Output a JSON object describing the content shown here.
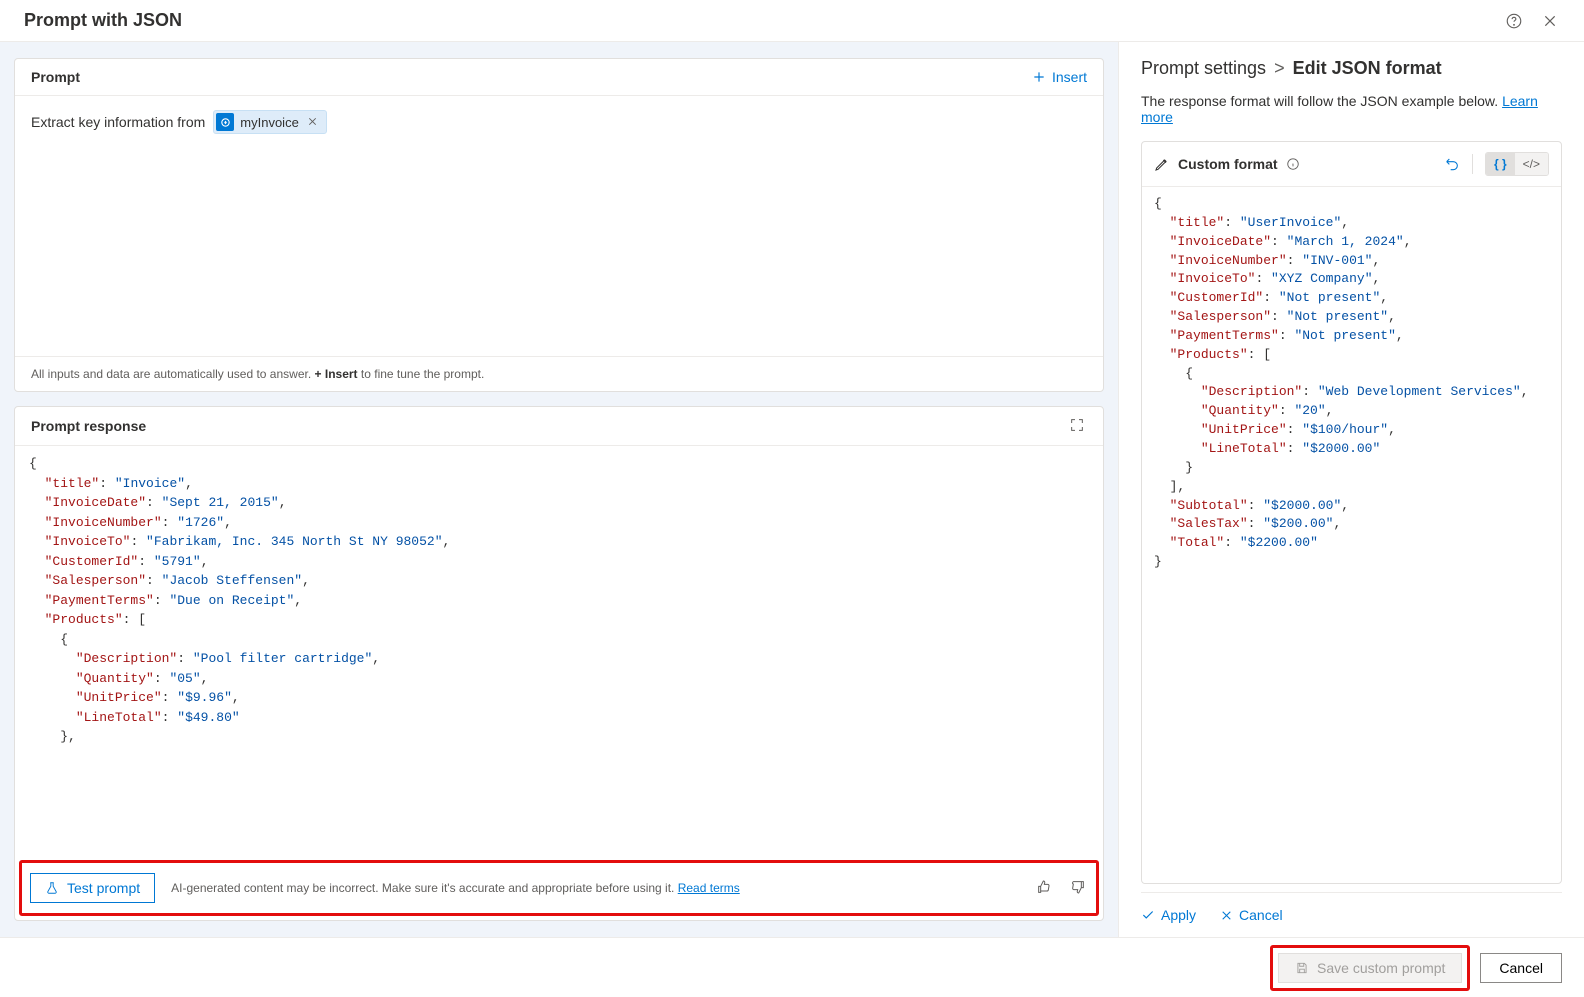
{
  "header": {
    "title": "Prompt with JSON"
  },
  "prompt": {
    "title": "Prompt",
    "insert_label": "Insert",
    "text": "Extract key information from",
    "chip_label": "myInvoice",
    "hint_prefix": "All inputs and data are automatically used to answer.",
    "hint_bold": "+ Insert",
    "hint_suffix": "to fine tune the prompt."
  },
  "response": {
    "title": "Prompt response",
    "test_label": "Test prompt",
    "disclaimer": "AI-generated content may be incorrect. Make sure it's accurate and appropriate before using it.",
    "read_terms": "Read terms",
    "json": {
      "title": "Invoice",
      "InvoiceDate": "Sept 21, 2015",
      "InvoiceNumber": "1726",
      "InvoiceTo": "Fabrikam, Inc. 345 North St NY 98052",
      "CustomerId": "5791",
      "Salesperson": "Jacob Steffensen",
      "PaymentTerms": "Due on Receipt",
      "Products": [
        {
          "Description": "Pool filter cartridge",
          "Quantity": "05",
          "UnitPrice": "$9.96",
          "LineTotal": "$49.80"
        }
      ]
    }
  },
  "settings": {
    "breadcrumb_root": "Prompt settings",
    "breadcrumb_leaf": "Edit JSON format",
    "description": "The response format will follow the JSON example below.",
    "learn_more": "Learn more",
    "format_label": "Custom format",
    "apply": "Apply",
    "cancel": "Cancel",
    "json": {
      "title": "UserInvoice",
      "InvoiceDate": "March 1, 2024",
      "InvoiceNumber": "INV-001",
      "InvoiceTo": "XYZ Company",
      "CustomerId": "Not present",
      "Salesperson": "Not present",
      "PaymentTerms": "Not present",
      "Products": [
        {
          "Description": "Web Development Services",
          "Quantity": "20",
          "UnitPrice": "$100/hour",
          "LineTotal": "$2000.00"
        }
      ],
      "Subtotal": "$2000.00",
      "SalesTax": "$200.00",
      "Total": "$2200.00"
    }
  },
  "footer": {
    "save": "Save custom prompt",
    "cancel": "Cancel"
  }
}
